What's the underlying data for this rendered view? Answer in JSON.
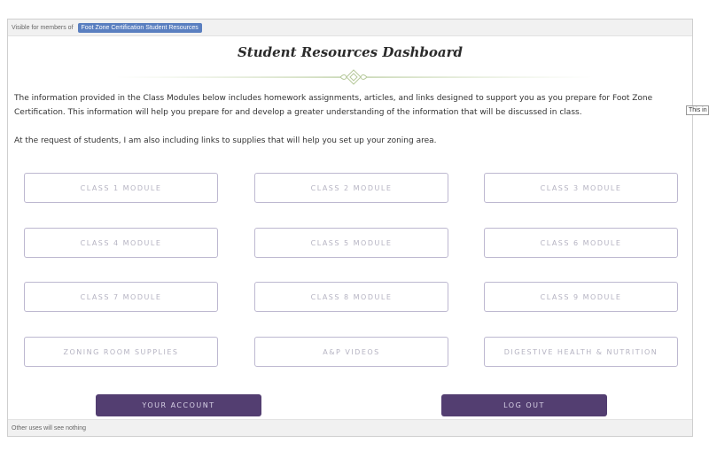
{
  "visibility": {
    "prefix": "Visible for members of",
    "group": "Foot Zone Certification Student Resources"
  },
  "page": {
    "title": "Student Resources Dashboard",
    "intro": "The information provided in the Class Modules below includes homework assignments, articles, and links designed to support you as you prepare for Foot Zone Certification. This information will help you prepare for and develop a greater understanding of the information that will be discussed in class.",
    "supplies_note": "At the request of students, I am also including links to supplies that will help you set up your zoning area."
  },
  "modules": [
    "CLASS 1 MODULE",
    "CLASS 2 MODULE",
    "CLASS 3 MODULE",
    "CLASS 4 MODULE",
    "CLASS 5 MODULE",
    "CLASS 6 MODULE",
    "CLASS 7 MODULE",
    "CLASS 8 MODULE",
    "CLASS 9 MODULE",
    "ZONING ROOM SUPPLIES",
    "A&P VIDEOS",
    "DIGESTIVE HEALTH & NUTRITION"
  ],
  "actions": {
    "account": "YOUR ACCOUNT",
    "logout": "LOG OUT"
  },
  "footer": {
    "note": "Other uses will see nothing"
  },
  "tooltip": {
    "text": "This in"
  },
  "colors": {
    "badge": "#5a7fc0",
    "primary_button": "#533e71",
    "outline_border": "#bdb8d0"
  }
}
